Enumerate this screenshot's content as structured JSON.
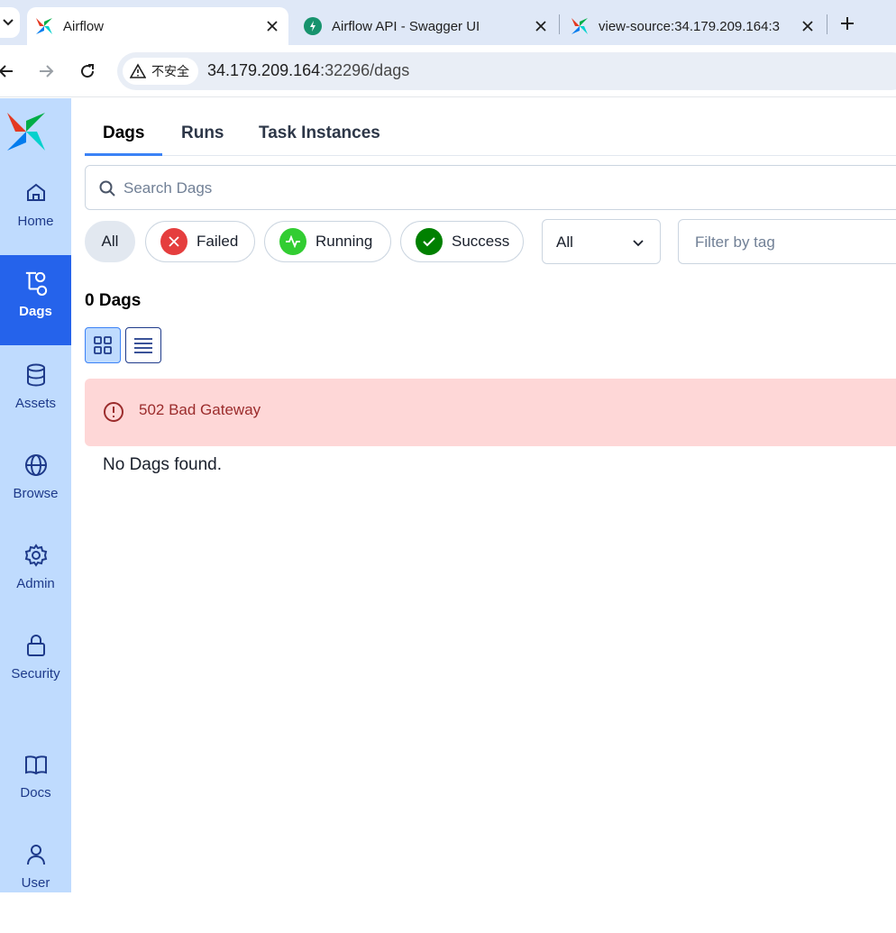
{
  "browser": {
    "tabs": [
      {
        "title": "Airflow",
        "active": true,
        "icon": "airflow-pinwheel-icon"
      },
      {
        "title": "Airflow API - Swagger UI",
        "active": false,
        "icon": "swagger-icon"
      },
      {
        "title": "view-source:34.179.209.164:3",
        "active": false,
        "icon": "airflow-pinwheel-icon"
      }
    ],
    "security_label": "不安全",
    "url_host": "34.179.209.164",
    "url_path": ":32296/dags"
  },
  "sidebar": {
    "items": [
      {
        "label": "Home",
        "icon": "home-icon",
        "active": false
      },
      {
        "label": "Dags",
        "icon": "dags-icon",
        "active": true
      },
      {
        "label": "Assets",
        "icon": "database-icon",
        "active": false
      },
      {
        "label": "Browse",
        "icon": "globe-icon",
        "active": false
      },
      {
        "label": "Admin",
        "icon": "gear-icon",
        "active": false
      },
      {
        "label": "Security",
        "icon": "lock-icon",
        "active": false
      },
      {
        "label": "Docs",
        "icon": "book-icon",
        "active": false
      },
      {
        "label": "User",
        "icon": "user-icon",
        "active": false
      }
    ]
  },
  "main": {
    "tabs": [
      "Dags",
      "Runs",
      "Task Instances"
    ],
    "active_tab": "Dags",
    "search_placeholder": "Search Dags",
    "state_filters": [
      {
        "label": "All",
        "selected": true
      },
      {
        "label": "Failed",
        "color": "#e53e3e"
      },
      {
        "label": "Running",
        "color": "#32cd32"
      },
      {
        "label": "Success",
        "color": "#008000"
      }
    ],
    "paused_select_value": "All",
    "tag_filter_placeholder": "Filter by tag",
    "dag_count": "0 Dags",
    "error_message": "502 Bad Gateway",
    "empty_message": "No Dags found."
  },
  "colors": {
    "accent": "#2563eb",
    "sidebar_bg": "#bfdbfe",
    "error_bg": "#fed7d7",
    "error_text": "#9b2c2c"
  }
}
